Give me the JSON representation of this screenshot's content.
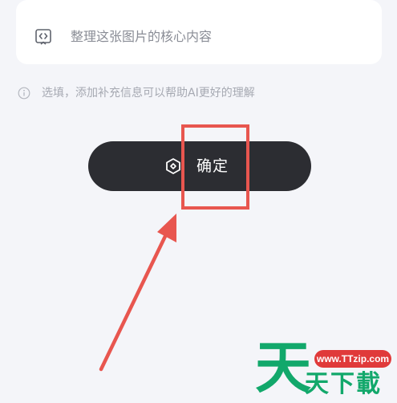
{
  "prompt": {
    "icon": "code-bracket-icon",
    "text": "整理这张图片的核心内容"
  },
  "hint": {
    "icon": "info-circle-icon",
    "text": "选填，添加补充信息可以帮助AI更好的理解"
  },
  "confirm": {
    "icon": "ai-sparkle-icon",
    "label": "确定"
  },
  "annotation": {
    "color": "#e8564f"
  },
  "watermark": {
    "url": "www.TTzip.com",
    "big_char": "天",
    "sub_text": "天下載",
    "brand_color": "#12a86b",
    "badge_color": "#e03a3a"
  },
  "colors": {
    "background": "#f4f5f9",
    "button": "#2c2d32"
  }
}
